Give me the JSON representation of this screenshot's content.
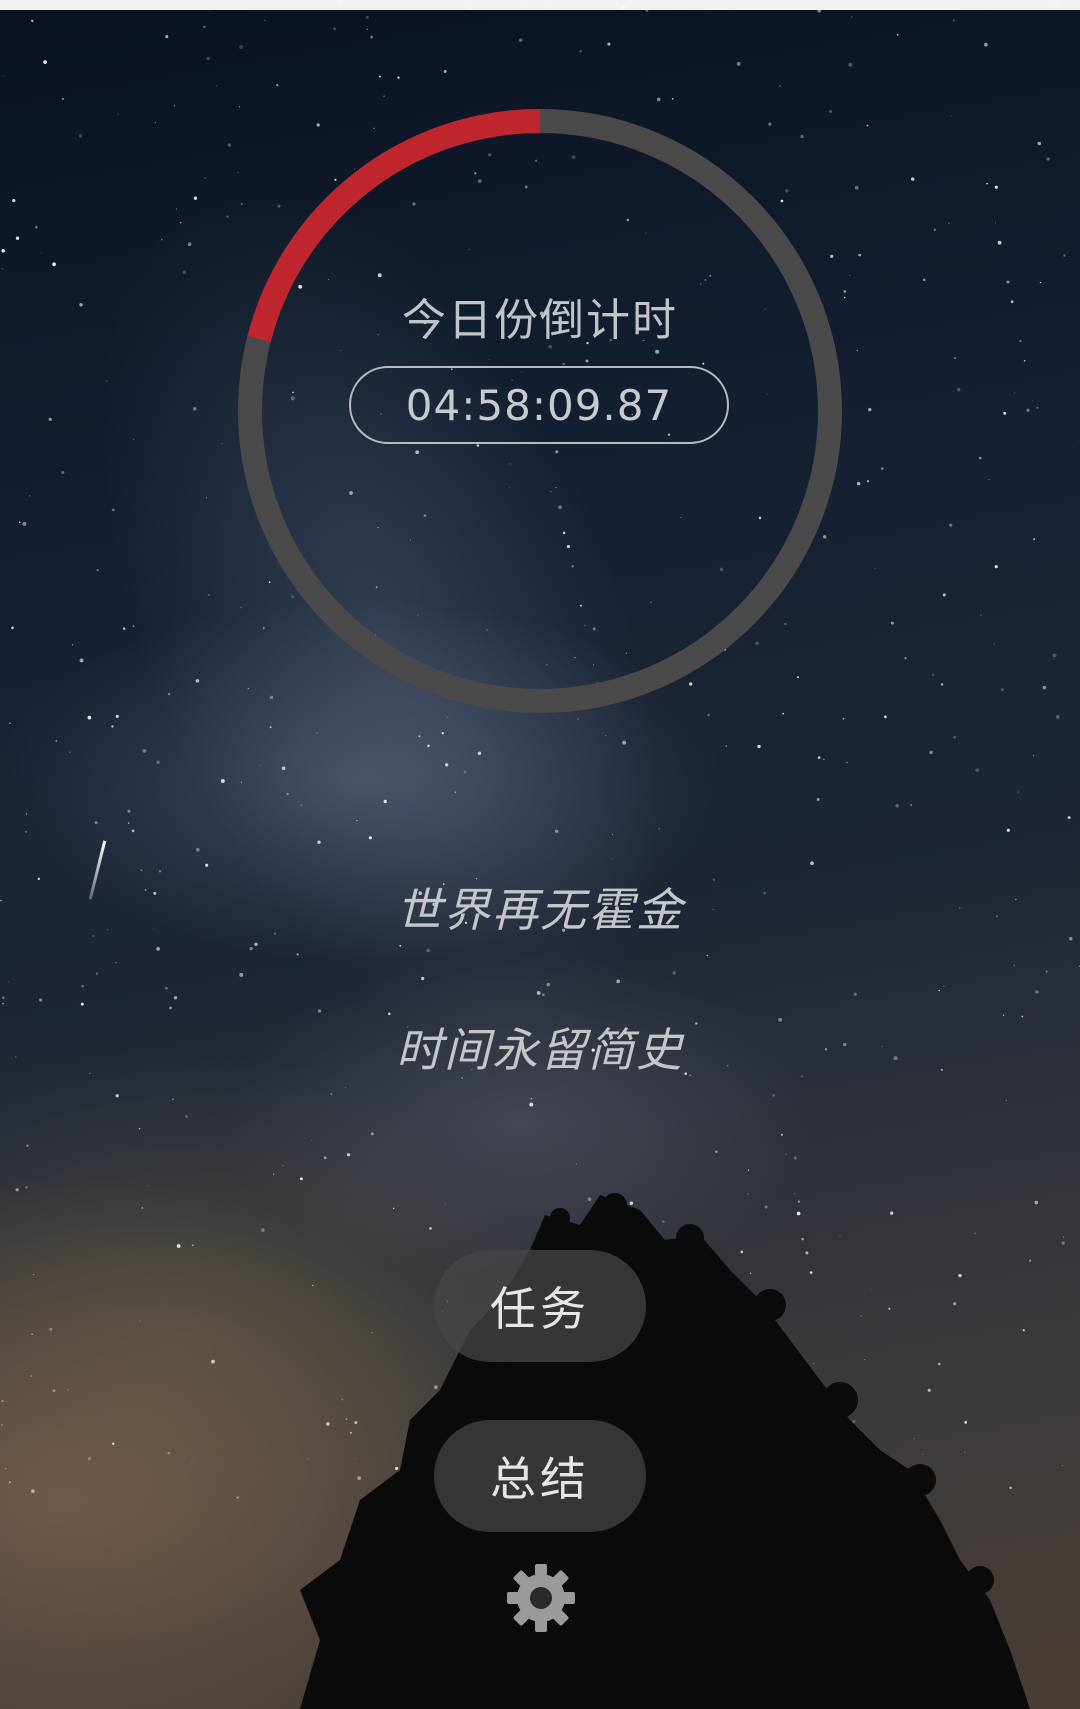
{
  "countdown": {
    "title": "今日份倒计时",
    "time": "04:58:09.87",
    "elapsed_fraction": 0.21
  },
  "quotes": {
    "line1": "世界再无霍金",
    "line2": "时间永留简史"
  },
  "buttons": {
    "task_label": "任务",
    "summary_label": "总结"
  },
  "icons": {
    "settings": "gear-icon"
  },
  "colors": {
    "progress_accent": "#c0262e",
    "ring_track": "#4a4a4a"
  }
}
